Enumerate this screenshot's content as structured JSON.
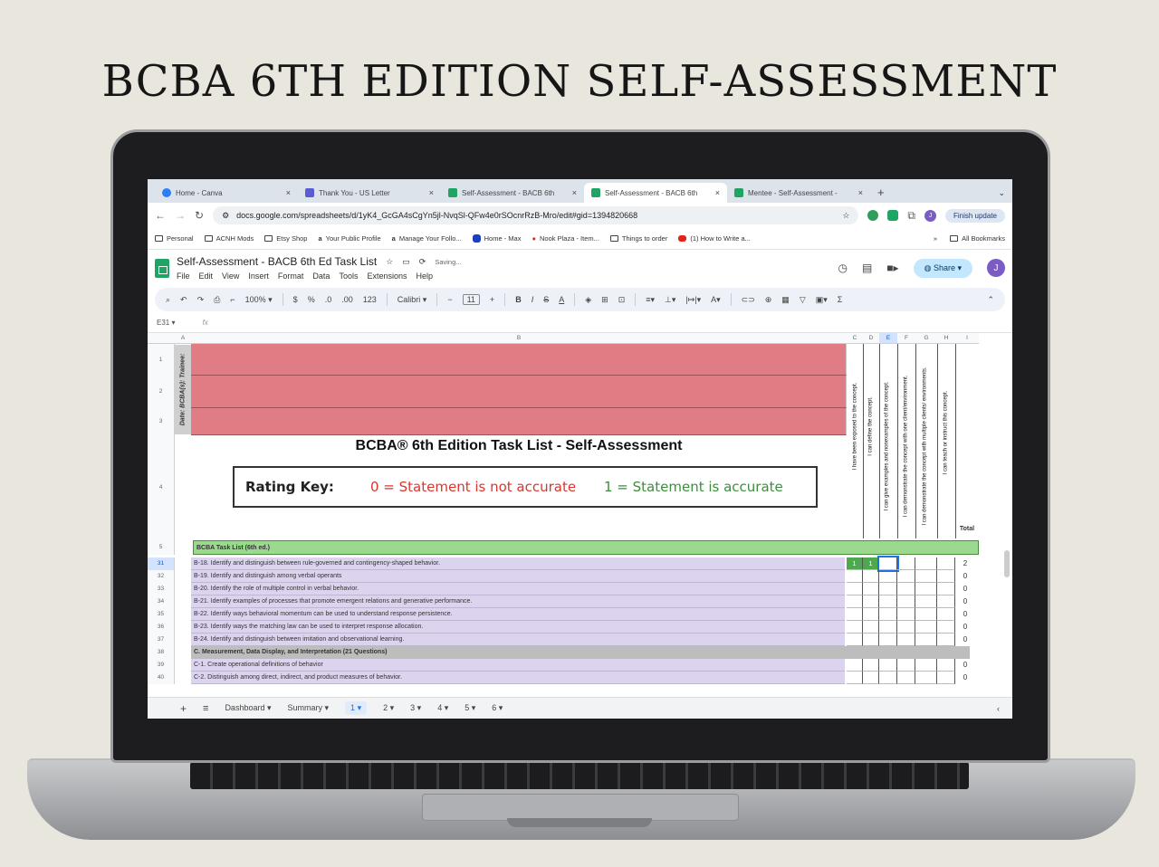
{
  "headline": "BCBA 6TH EDITION SELF-ASSESSMENT",
  "browser": {
    "tabs": [
      {
        "label": "Home - Canva",
        "color": "#2d7ff9"
      },
      {
        "label": "Thank You - US Letter",
        "color": "#5b5bd6"
      },
      {
        "label": "Self-Assessment - BACB 6th",
        "color": "#1fa463"
      },
      {
        "label": "Self-Assessment - BACB 6th",
        "color": "#1fa463"
      },
      {
        "label": "Mentee - Self-Assessment -",
        "color": "#1fa463"
      }
    ],
    "url": "docs.google.com/spreadsheets/d/1yK4_GcGA4sCgYn5jl-NvqSl-QFw4e0rSOcnrRzB-Mro/edit#gid=1394820668",
    "finish_update": "Finish update",
    "avatar": "J",
    "bookmarks": [
      "Personal",
      "ACNH Mods",
      "Etsy Shop",
      "Your Public Profile",
      "Manage Your Follo...",
      "Home - Max",
      "Nook Plaza - Item...",
      "Things to order",
      "(1) How to Write a..."
    ],
    "all_bookmarks": "All Bookmarks"
  },
  "sheets": {
    "title": "Self-Assessment - BACB 6th Ed Task List",
    "saving": "Saving...",
    "menus": [
      "File",
      "Edit",
      "View",
      "Insert",
      "Format",
      "Data",
      "Tools",
      "Extensions",
      "Help"
    ],
    "share": "Share",
    "zoom": "100%",
    "font": "Calibri",
    "font_size": "11",
    "cell_ref": "E31",
    "fx": "fx",
    "columns": [
      "A",
      "B",
      "C",
      "D",
      "E",
      "F",
      "G",
      "H",
      "I"
    ],
    "trainee_label": "Date: BCBA(s): Trainee:",
    "sheet_title": "BCBA® 6th Edition Task List - Self-Assessment",
    "rating_key": "Rating Key:",
    "rating_0": "0 = Statement is not accurate",
    "rating_1": "1 = Statement is accurate",
    "criteria": [
      "I have been exposed to the concept.",
      "I can define the concept.",
      "I can give examples and nonexamples of the concept.",
      "I can demonstrate the concept with one client/environment.",
      "I can demonstrate the concept with multiple clients/ environments.",
      "I can teach or instruct this concept."
    ],
    "total_label": "Total",
    "section_header": "BCBA Task List (6th ed.)",
    "rows": [
      {
        "num": "31",
        "text": "B-18. Identify and distinguish between rule-governed and contingency-shaped behavior.",
        "c": "1",
        "d": "1",
        "total": "2"
      },
      {
        "num": "32",
        "text": "B-19. Identify and distinguish among verbal operants",
        "total": "0"
      },
      {
        "num": "33",
        "text": "B-20. Identify the role of multiple control in verbal behavior.",
        "total": "0"
      },
      {
        "num": "34",
        "text": "B-21. Identify examples of processes that promote emergent relations and generative performance.",
        "total": "0"
      },
      {
        "num": "35",
        "text": "B-22. Identify ways behavioral momentum can be used to understand response persistence.",
        "total": "0"
      },
      {
        "num": "36",
        "text": "B-23. Identify ways the matching law can be used to interpret response allocation.",
        "total": "0"
      },
      {
        "num": "37",
        "text": "B-24. Identify and distinguish between imitation and observational learning.",
        "total": "0"
      },
      {
        "num": "38",
        "text": "C. Measurement, Data Display, and Interpretation (21 Questions)",
        "section": true,
        "total": ""
      },
      {
        "num": "39",
        "text": "C-1. Create operational definitions of behavior",
        "total": "0"
      },
      {
        "num": "40",
        "text": "C-2. Distinguish among direct, indirect, and product measures of behavior.",
        "total": "0"
      }
    ],
    "sheet_tabs": [
      "Dashboard",
      "Summary",
      "1",
      "2",
      "3",
      "4",
      "5",
      "6"
    ]
  }
}
